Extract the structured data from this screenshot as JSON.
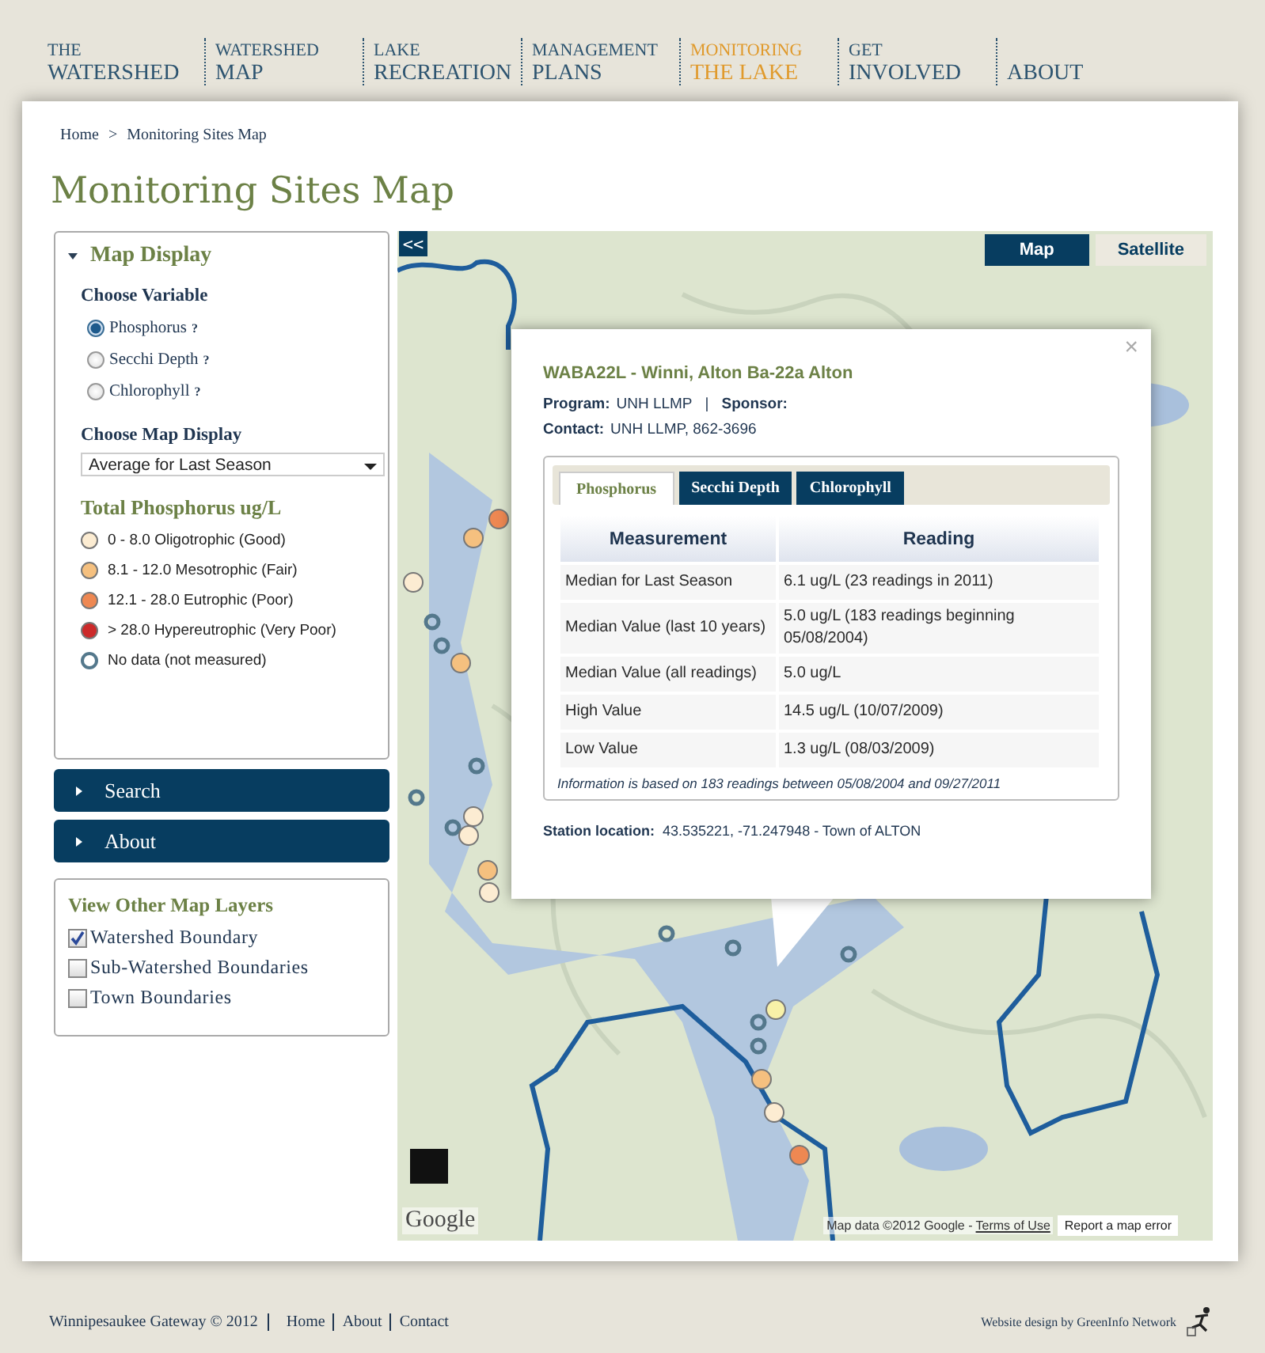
{
  "nav": [
    {
      "line1": "THE",
      "line2": "WATERSHED",
      "selected": false
    },
    {
      "line1": "WATERSHED",
      "line2": "MAP",
      "selected": false
    },
    {
      "line1": "LAKE",
      "line2": "RECREATION",
      "selected": false
    },
    {
      "line1": "MANAGEMENT",
      "line2": "PLANS",
      "selected": false
    },
    {
      "line1": "MONITORING",
      "line2": "THE LAKE",
      "selected": true
    },
    {
      "line1": "GET",
      "line2": "INVOLVED",
      "selected": false
    },
    {
      "line2": "ABOUT",
      "selected": false
    }
  ],
  "breadcrumb": {
    "items": [
      "Home",
      "Monitoring Sites Map"
    ],
    "separator": ">"
  },
  "title": "Monitoring Sites Map",
  "sidebar": {
    "map_display": {
      "title": "Map Display",
      "expanded": true,
      "choose_variable": "Choose Variable",
      "variables": [
        {
          "label": "Phosphorus",
          "help": "?",
          "selected": true
        },
        {
          "label": "Secchi Depth",
          "help": "?",
          "selected": false
        },
        {
          "label": "Chlorophyll",
          "help": "?",
          "selected": false
        }
      ],
      "choose_display": "Choose Map Display",
      "display_select": {
        "value": "Average for Last Season"
      },
      "legend": {
        "title": "Total Phosphorus ug/L",
        "items": [
          {
            "label": "0 - 8.0 Oligotrophic (Good)",
            "kind": "filled",
            "color": "#fcecd2"
          },
          {
            "label": "8.1 - 12.0 Mesotrophic (Fair)",
            "kind": "filled",
            "color": "#f5c07f"
          },
          {
            "label": "12.1 - 28.0 Eutrophic (Poor)",
            "kind": "filled",
            "color": "#ee8852"
          },
          {
            "label": "> 28.0 Hypereutrophic (Very Poor)",
            "kind": "filled",
            "color": "#cc2a2a"
          },
          {
            "label": "No data (not measured)",
            "kind": "ring",
            "color": "#54788c"
          }
        ]
      }
    },
    "accordions": [
      {
        "label": "Search",
        "expanded": false
      },
      {
        "label": "About",
        "expanded": false
      }
    ],
    "layers": {
      "title": "View Other Map Layers",
      "items": [
        {
          "label": "Watershed Boundary",
          "checked": true
        },
        {
          "label": "Sub-Watershed Boundaries",
          "checked": false
        },
        {
          "label": "Town Boundaries",
          "checked": false
        }
      ]
    }
  },
  "map": {
    "collapse_button": "<<",
    "types": [
      {
        "label": "Map",
        "selected": true
      },
      {
        "label": "Satellite",
        "selected": false
      }
    ],
    "logo": "Google",
    "attribution": "Map data ©2012 Google - ",
    "terms": "Terms of Use",
    "report_error": "Report a map error",
    "popup": {
      "close": "×",
      "station": "WABA22L - Winni, Alton Ba-22a Alton",
      "program_label": "Program:",
      "program": "UNH LLMP",
      "divider": "|",
      "sponsor_label": "Sponsor:",
      "contact_label": "Contact:",
      "contact": "UNH LLMP, 862-3696",
      "tabs": [
        {
          "label": "Phosphorus",
          "selected": true
        },
        {
          "label": "Secchi Depth",
          "selected": false
        },
        {
          "label": "Chlorophyll",
          "selected": false
        }
      ],
      "table": {
        "columns": [
          "Measurement",
          "Reading"
        ],
        "rows": [
          [
            "Median for Last Season",
            "6.1 ug/L (23 readings in 2011)"
          ],
          [
            "Median Value (last 10 years)",
            "5.0 ug/L (183 readings beginning 05/08/2004)"
          ],
          [
            "Median Value (all readings)",
            "5.0 ug/L"
          ],
          [
            "High Value",
            "14.5 ug/L (10/07/2009)"
          ],
          [
            "Low Value",
            "1.3 ug/L (08/03/2009)"
          ]
        ]
      },
      "note": "Information is based on 183 readings between 05/08/2004 and 09/27/2011",
      "location_label": "Station location:",
      "location": "43.535221, -71.247948 - Town of ALTON"
    }
  },
  "footer": {
    "copyright": "Winnipesaukee Gateway © 2012",
    "links": [
      "Home",
      "About",
      "Contact"
    ],
    "credit": "Website design by GreenInfo Network"
  }
}
